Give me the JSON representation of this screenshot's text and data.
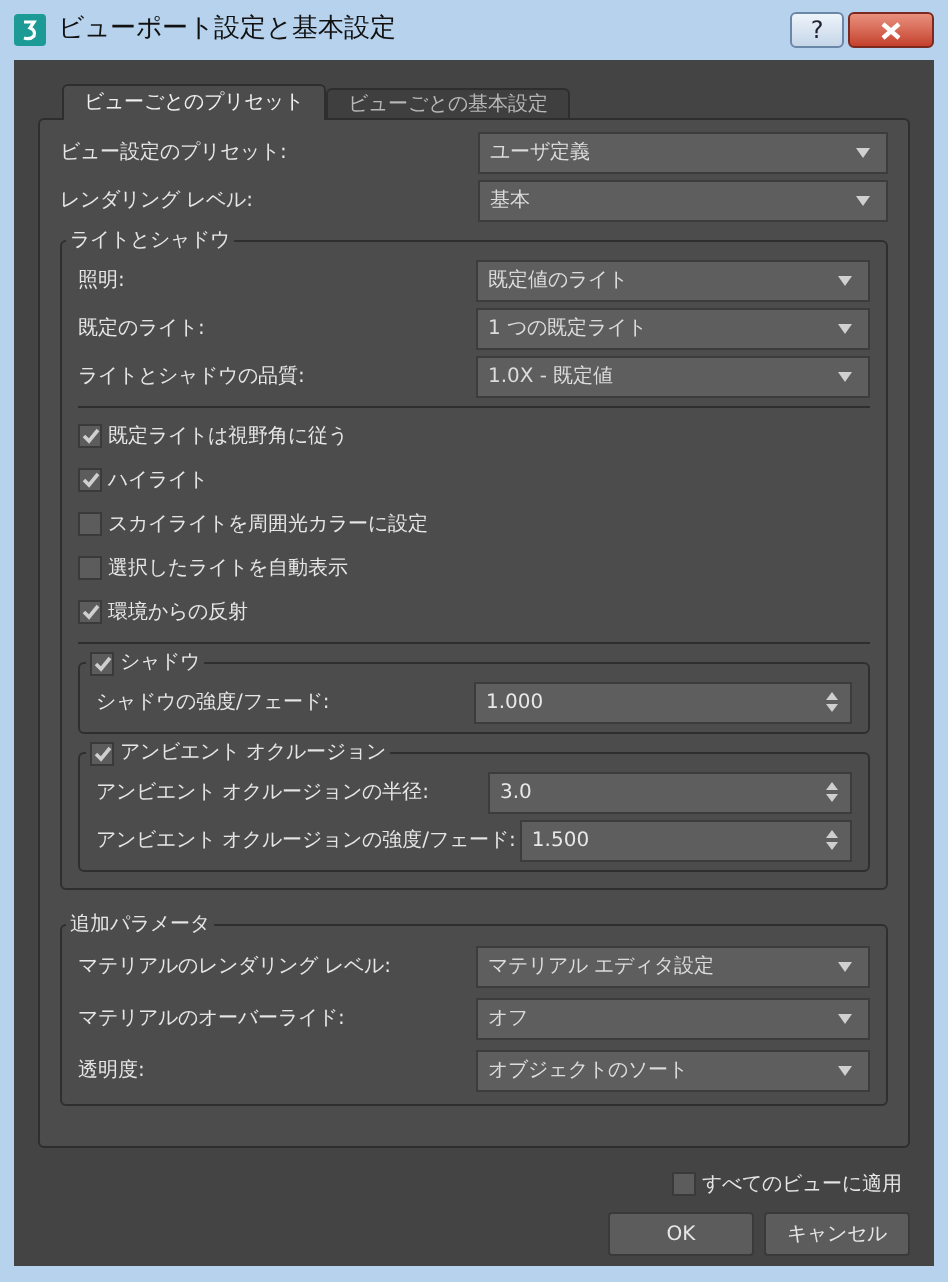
{
  "window": {
    "title": "ビューポート設定と基本設定",
    "help_button": "?"
  },
  "tabs": [
    {
      "label": "ビューごとのプリセット",
      "selected": true
    },
    {
      "label": "ビューごとの基本設定",
      "selected": false
    }
  ],
  "top_fields": [
    {
      "label": "ビュー設定のプリセット:",
      "value": "ユーザ定義",
      "kind": "dropdown"
    },
    {
      "label": "レンダリング レベル:",
      "value": "基本",
      "kind": "dropdown"
    }
  ],
  "lights_and_shadows": {
    "title": "ライトとシャドウ",
    "fields": [
      {
        "label": "照明:",
        "value": "既定値のライト",
        "kind": "dropdown"
      },
      {
        "label": "既定のライト:",
        "value": "1 つの既定ライト",
        "kind": "dropdown"
      },
      {
        "label": "ライトとシャドウの品質:",
        "value": "1.0X - 既定値",
        "kind": "dropdown"
      }
    ],
    "checkboxes": [
      {
        "label": "既定ライトは視野角に従う",
        "checked": true
      },
      {
        "label": "ハイライト",
        "checked": true
      },
      {
        "label": "スカイライトを周囲光カラーに設定",
        "checked": false
      },
      {
        "label": "選択したライトを自動表示",
        "checked": false
      },
      {
        "label": "環境からの反射",
        "checked": true
      }
    ],
    "groups": [
      {
        "title": "シャドウ",
        "checked": true,
        "fields": [
          {
            "label": "シャドウの強度/フェード:",
            "value": "1.000",
            "kind": "spinner"
          }
        ]
      },
      {
        "title": "アンビエント オクルージョン",
        "checked": true,
        "fields": [
          {
            "label": "アンビエント オクルージョンの半径:",
            "value": "3.0",
            "kind": "spinner"
          },
          {
            "label": "アンビエント オクルージョンの強度/フェード:",
            "value": "1.500",
            "kind": "spinner"
          }
        ]
      }
    ]
  },
  "additional_parameters": {
    "title": "追加パラメータ",
    "fields": [
      {
        "label": "マテリアルのレンダリング レベル:",
        "value": "マテリアル エディタ設定",
        "kind": "dropdown"
      },
      {
        "label": "マテリアルのオーバーライド:",
        "value": "オフ",
        "kind": "dropdown"
      },
      {
        "label": "透明度:",
        "value": "オブジェクトのソート",
        "kind": "dropdown"
      }
    ]
  },
  "apply_all": {
    "label": "すべてのビューに適用",
    "checked": false
  },
  "buttons": [
    "OK",
    "キャンセル"
  ]
}
